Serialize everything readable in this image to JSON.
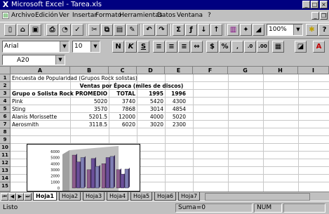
{
  "window": {
    "title": "Microsoft Excel - Tarea.xls",
    "minimize": "_",
    "maximize": "□",
    "close": "×"
  },
  "menu": [
    "Archivo",
    "Edición",
    "Ver",
    "Insertar",
    "Formato",
    "Herramientas",
    "Datos",
    "Ventana",
    "?"
  ],
  "doc_controls": {
    "minimize": "_",
    "restore": "❐"
  },
  "toolbar": {
    "zoom": "100%",
    "font_name": "Arial",
    "font_size": "10",
    "bold": "N",
    "italic": "K",
    "underline": "S",
    "percent": "%"
  },
  "formula_bar": {
    "name_box": "A20",
    "content": ""
  },
  "columns": [
    "A",
    "B",
    "C",
    "D",
    "E",
    "F",
    "G",
    "H",
    "I"
  ],
  "rows": [
    "1",
    "2",
    "3",
    "4",
    "5",
    "6",
    "7",
    "8",
    "9",
    "10",
    "11",
    "12",
    "13",
    "14",
    "15"
  ],
  "cells": {
    "r1": "Encuesta de Popularidad (Grupos Rock solistas)",
    "r2": "Ventas por Época (miles de discos)",
    "r3": [
      "Grupo o Solista Rock",
      "PROMEDIO",
      "TOTAL",
      "1995",
      "1996"
    ],
    "r4": [
      "Pink",
      "5020",
      "3740",
      "5420",
      "4300"
    ],
    "r5": [
      "Sting",
      "3570",
      "7868",
      "3014",
      "4854"
    ],
    "r6": [
      "Alanis Morissette",
      "5201.5",
      "12000",
      "4000",
      "5020"
    ],
    "r7": [
      "Aerosmith",
      "3118.5",
      "6020",
      "3020",
      "2300"
    ]
  },
  "chart_data": {
    "type": "bar",
    "ytick_labels": [
      "6000",
      "5000",
      "4000",
      "3000",
      "2000",
      "1000",
      "0"
    ],
    "colors": [
      "#8e5c8e",
      "#6b4f9a",
      "#7f7fb5"
    ]
  },
  "sheet_tabs": [
    "Hoja1",
    "Hoja2",
    "Hoja3",
    "Hoja4",
    "Hoja5",
    "Hoja6",
    "Hoja7"
  ],
  "tab_nav": [
    "⏮",
    "◀",
    "▶",
    "⏭"
  ],
  "status": {
    "ready": "Listo",
    "sum": "Suma=0",
    "num": "NUM"
  }
}
